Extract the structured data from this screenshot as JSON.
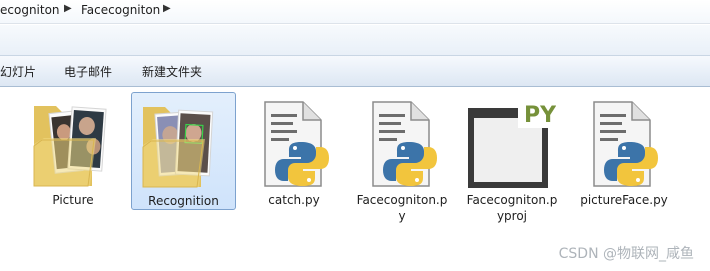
{
  "breadcrumb": {
    "items": [
      "ecogniton",
      "Facecogniton"
    ]
  },
  "toolbar": {
    "items": [
      "幻灯片",
      "电子邮件",
      "新建文件夹"
    ]
  },
  "files": [
    {
      "name": "Picture",
      "type": "folder",
      "icon": "folder-photo-icon",
      "selected": false
    },
    {
      "name": "Recognition",
      "type": "folder",
      "icon": "folder-photo-icon",
      "selected": true
    },
    {
      "name": "catch.py",
      "type": "python",
      "icon": "python-file-icon",
      "selected": false
    },
    {
      "name_line1": "Facecogniton.p",
      "name_line2": "y",
      "type": "python",
      "icon": "python-file-icon",
      "selected": false
    },
    {
      "name_line1": "Facecogniton.p",
      "name_line2": "yproj",
      "type": "pyproj",
      "icon": "pyproj-file-icon",
      "selected": false
    },
    {
      "name": "pictureFace.py",
      "type": "python",
      "icon": "python-file-icon",
      "selected": false
    }
  ],
  "watermark": "CSDN @物联网_咸鱼",
  "colors": {
    "selection_fill": "#cfe3fb",
    "selection_border": "#7da2ce",
    "python_blue": "#3c74a9",
    "python_yellow": "#f2c53d",
    "folder_yellow": "#f2d77a"
  }
}
